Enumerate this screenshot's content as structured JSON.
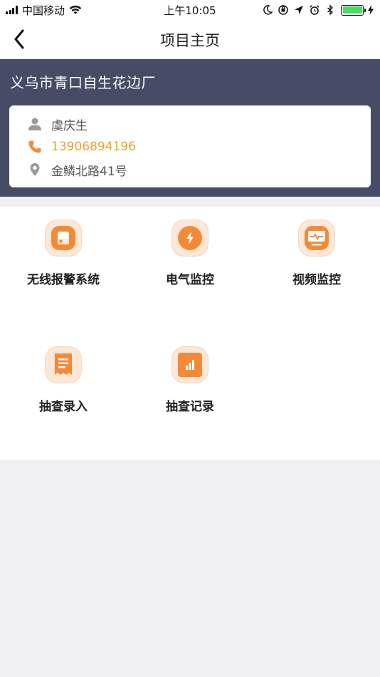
{
  "status_bar": {
    "carrier": "中国移动",
    "time": "上午10:05"
  },
  "nav": {
    "title": "项目主页"
  },
  "project": {
    "name": "义乌市青口自生花边厂",
    "contact_name": "虞庆生",
    "phone": "13906894196",
    "address": "金鳞北路41号"
  },
  "menu": {
    "items": [
      {
        "label": "无线报警系统",
        "icon": "wireless-alarm-icon"
      },
      {
        "label": "电气监控",
        "icon": "lightning-icon"
      },
      {
        "label": "视频监控",
        "icon": "video-monitor-icon"
      },
      {
        "label": "抽查录入",
        "icon": "receipt-icon"
      },
      {
        "label": "抽查记录",
        "icon": "bar-chart-icon"
      }
    ]
  },
  "colors": {
    "header_bg": "#474c66",
    "accent": "#f58a36",
    "phone": "#f0a030"
  }
}
